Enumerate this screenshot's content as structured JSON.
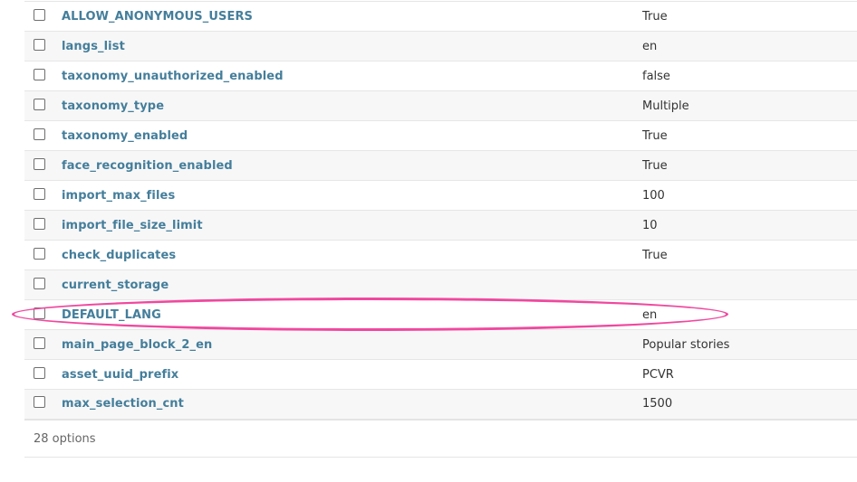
{
  "table": {
    "rows": [
      {
        "name": "ALLOW_ANONYMOUS_USERS",
        "value": "True"
      },
      {
        "name": "langs_list",
        "value": "en"
      },
      {
        "name": "taxonomy_unauthorized_enabled",
        "value": "false"
      },
      {
        "name": "taxonomy_type",
        "value": "Multiple"
      },
      {
        "name": "taxonomy_enabled",
        "value": "True"
      },
      {
        "name": "face_recognition_enabled",
        "value": "True"
      },
      {
        "name": "import_max_files",
        "value": "100"
      },
      {
        "name": "import_file_size_limit",
        "value": "10"
      },
      {
        "name": "check_duplicates",
        "value": "True"
      },
      {
        "name": "current_storage",
        "value": ""
      },
      {
        "name": "DEFAULT_LANG",
        "value": "en"
      },
      {
        "name": "main_page_block_2_en",
        "value": "Popular stories"
      },
      {
        "name": "asset_uuid_prefix",
        "value": "PCVR"
      },
      {
        "name": "max_selection_cnt",
        "value": "1500"
      }
    ]
  },
  "footer": {
    "count_label": "28 options"
  },
  "annotation": {
    "highlighted_row": "DEFAULT_LANG",
    "color": "#f0489f"
  },
  "colors": {
    "link": "#447e9b",
    "text": "#333333",
    "row_alt": "#f7f7f7"
  }
}
